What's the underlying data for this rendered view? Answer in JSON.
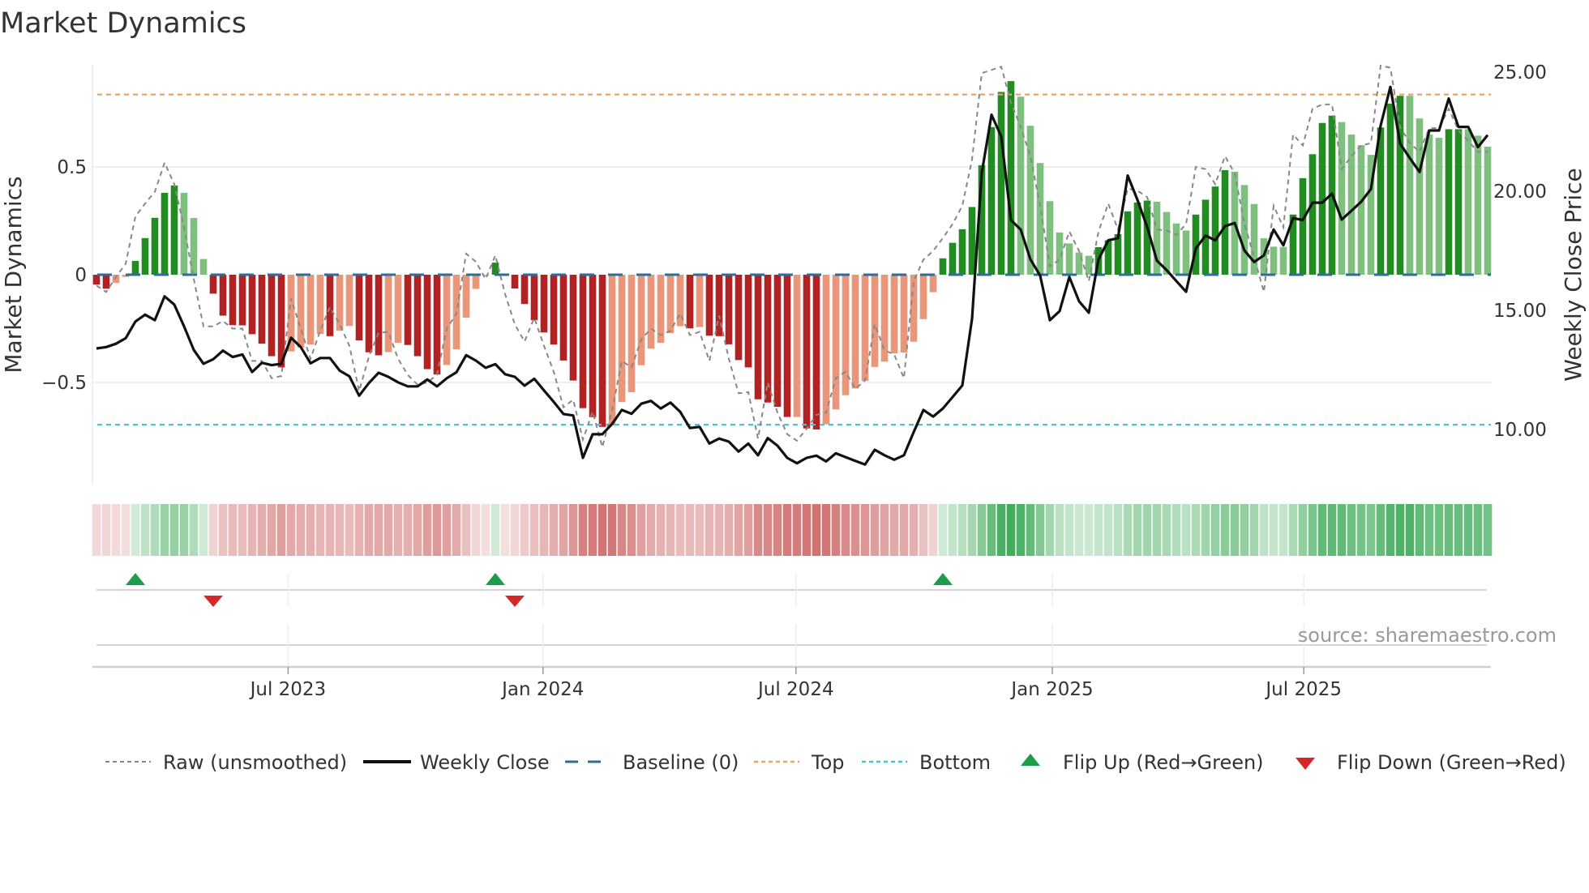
{
  "chart_data": {
    "type": "bar",
    "title": "Market Dynamics",
    "ylabel": "Market Dynamics",
    "y2label": "Weekly Close Price",
    "ylim": [
      -0.97,
      0.97
    ],
    "y2lim": [
      7.7,
      25.3
    ],
    "yticks": [
      {
        "value": 0.5,
        "label": "0.5"
      },
      {
        "value": 0,
        "label": "0"
      },
      {
        "value": -0.5,
        "label": "−0.5"
      }
    ],
    "y2ticks": [
      {
        "value": 25,
        "label": "25.00"
      },
      {
        "value": 20,
        "label": "20.00"
      },
      {
        "value": 15,
        "label": "15.00"
      },
      {
        "value": 10,
        "label": "10.00"
      }
    ],
    "xticks": [
      {
        "week": 19.7,
        "label": "Jul 2023"
      },
      {
        "week": 45.9,
        "label": "Jan 2024"
      },
      {
        "week": 71.9,
        "label": "Jul 2024"
      },
      {
        "week": 98.25,
        "label": "Jan 2025"
      },
      {
        "week": 124.1,
        "label": "Jul 2025"
      }
    ],
    "top_level": 0.836,
    "bottom_level": -0.696,
    "baseline": 0,
    "dynamics": [
      -0.046,
      -0.065,
      -0.038,
      -0.01,
      0.064,
      0.17,
      0.264,
      0.38,
      0.414,
      0.38,
      0.263,
      0.073,
      -0.088,
      -0.19,
      -0.234,
      -0.235,
      -0.276,
      -0.32,
      -0.378,
      -0.43,
      -0.356,
      -0.338,
      -0.324,
      -0.275,
      -0.285,
      -0.26,
      -0.238,
      -0.305,
      -0.36,
      -0.374,
      -0.359,
      -0.316,
      -0.326,
      -0.378,
      -0.438,
      -0.463,
      -0.419,
      -0.346,
      -0.199,
      -0.066,
      -0.005,
      0.056,
      -0.005,
      -0.064,
      -0.136,
      -0.211,
      -0.268,
      -0.324,
      -0.398,
      -0.491,
      -0.619,
      -0.661,
      -0.706,
      -0.7,
      -0.591,
      -0.545,
      -0.42,
      -0.343,
      -0.316,
      -0.271,
      -0.239,
      -0.249,
      -0.243,
      -0.283,
      -0.285,
      -0.323,
      -0.396,
      -0.43,
      -0.578,
      -0.593,
      -0.613,
      -0.66,
      -0.66,
      -0.713,
      -0.718,
      -0.694,
      -0.625,
      -0.559,
      -0.528,
      -0.493,
      -0.428,
      -0.403,
      -0.365,
      -0.361,
      -0.311,
      -0.206,
      -0.081,
      0.076,
      0.148,
      0.211,
      0.314,
      0.508,
      0.685,
      0.848,
      0.898,
      0.826,
      0.691,
      0.518,
      0.341,
      0.196,
      0.145,
      0.103,
      0.088,
      0.128,
      0.16,
      0.188,
      0.294,
      0.335,
      0.344,
      0.339,
      0.291,
      0.238,
      0.205,
      0.279,
      0.348,
      0.409,
      0.485,
      0.478,
      0.416,
      0.328,
      0.169,
      0.13,
      0.129,
      0.279,
      0.448,
      0.559,
      0.704,
      0.738,
      0.708,
      0.65,
      0.601,
      0.556,
      0.683,
      0.794,
      0.83,
      0.83,
      0.725,
      0.65,
      0.635,
      0.675,
      0.675,
      0.675,
      0.645,
      0.594
    ],
    "strengthening": [
      1,
      1,
      0,
      0,
      1,
      1,
      1,
      1,
      1,
      0,
      0,
      0,
      1,
      1,
      1,
      1,
      1,
      1,
      1,
      1,
      0,
      0,
      0,
      0,
      1,
      0,
      0,
      1,
      1,
      1,
      0,
      0,
      1,
      1,
      1,
      1,
      0,
      0,
      0,
      0,
      0,
      1,
      0,
      1,
      1,
      1,
      1,
      1,
      1,
      1,
      1,
      1,
      1,
      0,
      0,
      0,
      0,
      0,
      0,
      0,
      0,
      1,
      0,
      1,
      1,
      1,
      1,
      1,
      1,
      1,
      1,
      1,
      0,
      1,
      1,
      0,
      0,
      0,
      0,
      0,
      0,
      0,
      0,
      0,
      0,
      0,
      0,
      1,
      1,
      1,
      1,
      1,
      1,
      1,
      1,
      0,
      0,
      0,
      0,
      0,
      0,
      0,
      0,
      1,
      1,
      1,
      1,
      1,
      1,
      0,
      0,
      0,
      0,
      1,
      1,
      1,
      1,
      0,
      0,
      0,
      0,
      0,
      0,
      1,
      1,
      1,
      1,
      1,
      0,
      0,
      0,
      0,
      1,
      1,
      1,
      0,
      0,
      0,
      0,
      1,
      1,
      0,
      0,
      0
    ],
    "raw": [
      -0.05,
      -0.08,
      -0.01,
      0.05,
      0.27,
      0.33,
      0.385,
      0.52,
      0.42,
      0.22,
      -0.02,
      -0.24,
      -0.24,
      -0.215,
      -0.25,
      -0.25,
      -0.4,
      -0.4,
      -0.48,
      -0.47,
      -0.11,
      -0.25,
      -0.39,
      -0.26,
      -0.15,
      -0.23,
      -0.33,
      -0.54,
      -0.38,
      -0.27,
      -0.265,
      -0.39,
      -0.465,
      -0.51,
      -0.5,
      -0.465,
      -0.25,
      -0.18,
      0.0975,
      0.06,
      -0.02,
      0.09,
      -0.09,
      -0.23,
      -0.31,
      -0.2,
      -0.33,
      -0.45,
      -0.615,
      -0.58,
      -0.765,
      -0.635,
      -0.8,
      -0.63,
      -0.4,
      -0.43,
      -0.3,
      -0.25,
      -0.28,
      -0.26,
      -0.18,
      -0.28,
      -0.265,
      -0.4,
      -0.19,
      -0.39,
      -0.55,
      -0.545,
      -0.76,
      -0.5,
      -0.64,
      -0.74,
      -0.77,
      -0.715,
      -0.65,
      -0.64,
      -0.48,
      -0.45,
      -0.53,
      -0.49,
      -0.23,
      -0.35,
      -0.37,
      -0.48,
      -0.03,
      0.07,
      0.11,
      0.17,
      0.235,
      0.32,
      0.535,
      0.935,
      0.95,
      0.965,
      0.8,
      0.685,
      0.55,
      0.32,
      0.04,
      0.07,
      0.2,
      0.11,
      -0.03,
      0.2,
      0.33,
      0.21,
      0.4,
      0.39,
      0.36,
      0.21,
      0.205,
      0.185,
      0.235,
      0.5,
      0.49,
      0.42,
      0.55,
      0.47,
      0.235,
      0.08,
      -0.08,
      0.32,
      0.22,
      0.65,
      0.6,
      0.77,
      0.79,
      0.79,
      0.49,
      0.55,
      0.6,
      0.61,
      0.97,
      0.96,
      0.685,
      0.61,
      0.57,
      0.68,
      0.68,
      0.77,
      0.67,
      0.62,
      0.57,
      0.57
    ],
    "close": [
      13.4,
      13.46,
      13.6,
      13.83,
      14.53,
      14.82,
      14.59,
      15.59,
      15.24,
      14.33,
      13.34,
      12.76,
      12.95,
      13.31,
      13.04,
      13.15,
      12.41,
      12.8,
      12.7,
      12.76,
      13.85,
      13.46,
      12.78,
      13.0,
      13.0,
      12.47,
      12.23,
      11.42,
      11.95,
      12.38,
      12.21,
      11.98,
      11.81,
      11.81,
      12.1,
      11.81,
      12.15,
      12.4,
      13.12,
      12.89,
      12.59,
      12.74,
      12.32,
      12.21,
      11.84,
      12.13,
      11.64,
      11.16,
      10.65,
      10.59,
      8.81,
      9.8,
      9.8,
      10.23,
      10.82,
      10.66,
      11.08,
      11.2,
      10.88,
      11.13,
      10.74,
      10.06,
      10.11,
      9.41,
      9.62,
      9.49,
      9.07,
      9.41,
      8.92,
      9.64,
      9.32,
      8.81,
      8.58,
      8.81,
      8.9,
      8.66,
      9.0,
      8.84,
      8.68,
      8.53,
      9.15,
      8.92,
      8.73,
      8.92,
      9.89,
      10.82,
      10.54,
      10.88,
      11.36,
      11.85,
      14.65,
      20.77,
      23.21,
      22.3,
      18.79,
      18.39,
      17.14,
      16.46,
      14.59,
      14.97,
      16.4,
      15.38,
      14.9,
      17.14,
      17.94,
      18.03,
      20.66,
      19.64,
      18.5,
      17.09,
      16.69,
      16.23,
      15.78,
      17.6,
      18.14,
      17.94,
      18.53,
      18.67,
      17.51,
      17.03,
      17.31,
      18.39,
      17.73,
      18.87,
      18.79,
      19.52,
      19.52,
      19.9,
      18.81,
      19.18,
      19.56,
      20.09,
      22.76,
      24.38,
      22.0,
      21.39,
      20.81,
      22.55,
      22.55,
      23.89,
      22.7,
      22.7,
      21.85,
      22.36
    ],
    "flip_up_weeks": [
      4,
      41,
      87
    ],
    "flip_down_weeks": [
      12,
      43
    ],
    "legend": {
      "placement": "bottom",
      "raw": "Raw (unsmoothed)",
      "close": "Weekly Close",
      "baseline": "Baseline (0)",
      "top": "Top",
      "bottom": "Bottom",
      "flip_up": "Flip Up (Red→Green)",
      "flip_down": "Flip Down (Green→Red)"
    },
    "source": "source: sharemaestro.com",
    "colors": {
      "green_strong": "#228b22",
      "green_weak": "#7fbf7f",
      "red_strong": "#b22222",
      "red_weak": "#e9967a",
      "raw": "#888888",
      "close": "#111111",
      "baseline": "#2b6e9e",
      "top": "#f0a360",
      "bottom": "#3ec7de",
      "flip_up": "#1a9e4a",
      "flip_down": "#d62728"
    }
  }
}
